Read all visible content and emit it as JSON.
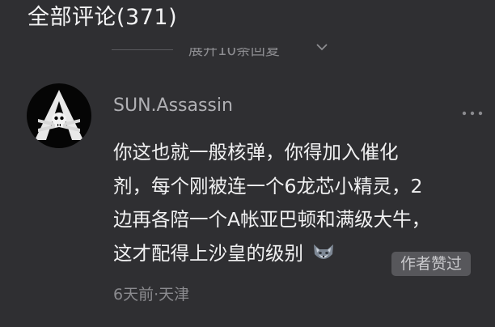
{
  "header": {
    "title": "全部评论(371)"
  },
  "replies": {
    "expand_label": "展开10条回复"
  },
  "comment": {
    "username": "SUN.Assassin",
    "lines": [
      "你这也就一般核弹，你得加入催化",
      "剂，每个刚被连一个6龙芯小精灵，2",
      "边再各陪一个A帐亚巴顿和满级大牛，",
      "这才配得上沙皇的级别"
    ],
    "emoji": "fox-face-icon",
    "badge": "作者赞过",
    "time": "6天前",
    "separator": "·",
    "location": "天津"
  }
}
